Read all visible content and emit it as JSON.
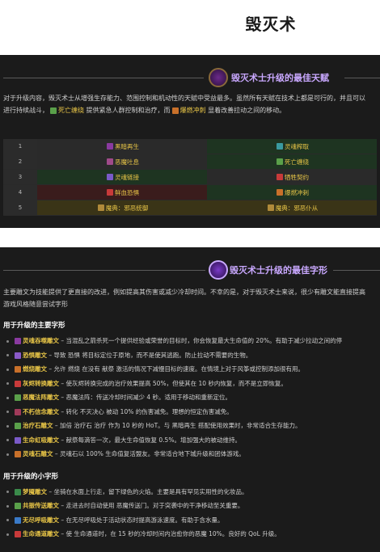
{
  "page_title": "毁灭术",
  "talents": {
    "heading": "毁灭术士升级的最佳天赋",
    "intro_line1": "对于升级内容，毁灭术士从增强生存能力、范围控制和机动性的天赋中受益最多。虽然所有天赋在技术上都是可行的，并且可以",
    "intro_line2_pre": "进行持续战斗，",
    "intro_link1": "死亡缠绕",
    "intro_line2_mid": " 提供紧急人群控制和治疗，而",
    "intro_link2": "爆燃冲刺",
    "intro_line2_post": " 显着改善拉动之间的移动。",
    "rows": [
      {
        "num": "1",
        "left": "黑暗再生",
        "right": "灵魂榨取"
      },
      {
        "num": "2",
        "left": "恶魔吐息",
        "right": "死亡缠绕"
      },
      {
        "num": "3",
        "left": "灵魂链接",
        "right": "牺牲契约"
      },
      {
        "num": "4",
        "left": "鲜血恐惧",
        "right": "爆燃冲刺"
      },
      {
        "num": "5",
        "left": "魔典：邪恶统御",
        "right": "魔典：邪恶仆从"
      }
    ]
  },
  "glyphs": {
    "heading": "毁灭术士升级的最佳字形",
    "intro_line1": "主要雕文为技能提供了更直接的改进，例如提高其伤害或减少冷却时间。不幸的是，对于毁灭术士来说，很少有雕文能直接提高",
    "intro_line2": "游戏风格随意尝试字形",
    "major_heading": "用于升级的主要字形",
    "major": [
      {
        "name": "灵魂吞噬雕文",
        "text": " – 当混乱之箭杀死一个提供经验或荣誉的目标时，你会恢复最大生命值的 20%。有助于减少拉动之间的停"
      },
      {
        "name": "恐惧雕文",
        "text": " – 导致 恐惧 将目标定位于原地，而不是使其逃跑。防止拉动不需要的生物。"
      },
      {
        "name": "燃烧雕文",
        "text": " – 允许 燃烧 在没有 献祭 激活的情况下减慢目标的速度。在情境上对于风筝或控制添加很有用。"
      },
      {
        "name": "灰烬转换雕文",
        "text": " – 使灰烬转换完成的治疗效果提高 50%，但使其在 10 秒内恢复，而不是立即恢复。"
      },
      {
        "name": "恶魔法阵雕文",
        "text": " – 恶魔法阵：传送冷却时间减少 4 秒。适用于移动和重新定位。"
      },
      {
        "name": "不朽信念雕文",
        "text": " – 转化 不灭决心 被动 10% 的伤害减免。理想的恒定伤害减免。"
      },
      {
        "name": "治疗石雕文",
        "text": " – 加倍 治疗石 治疗 作为 10 秒的 HoT。与 黑暗再生 搭配使用效果时，非常适合生存能力。"
      },
      {
        "name": "生命虹吸雕文",
        "text": " – 献祭每滴答一次，最大生命值恢复 0.5%。增加强大的被动维持。"
      },
      {
        "name": "灵魂石雕文",
        "text": " – 灵魂石以 100% 生命值复活盟友。非常适合地下城升级和团体游戏。"
      }
    ],
    "minor_heading": "用于升级的小字形",
    "minor": [
      {
        "name": "梦魇雕文",
        "text": " – 坐骑在水面上行走，留下绿色的火焰。主要是具有罕见实用性的化妆品。"
      },
      {
        "name": "共振传送雕文",
        "text": " – 走进去时自动使用 恶魔传送门。对于突袭中的干净移动至关重要。"
      },
      {
        "name": "无尽呼吸雕文",
        "text": " – 在无尽呼吸处于活动状态时提高游泳速度。有助于含水量。"
      },
      {
        "name": "生命通道雕文",
        "text": " – 使 生命通道时，在 15 秒的冷却时间内治愈你的恶魔 10%。良好的 QoL 升级。"
      }
    ]
  }
}
